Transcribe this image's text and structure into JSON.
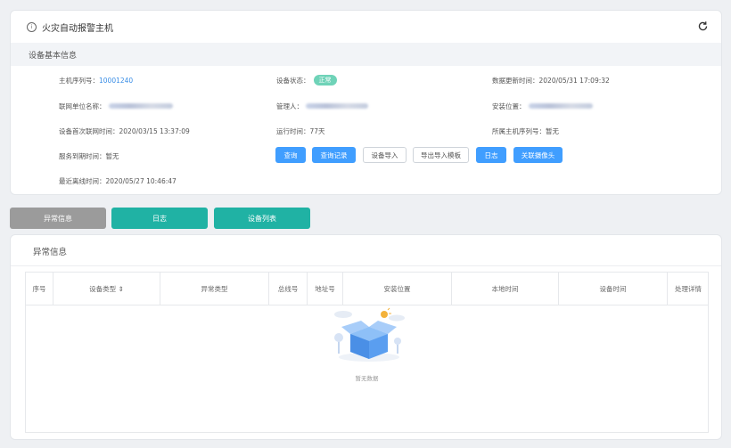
{
  "header": {
    "title": "火灾自动报警主机",
    "title_icon": "info-circle-icon",
    "refresh_icon": "refresh-icon"
  },
  "basic": {
    "section_title": "设备基本信息",
    "host_serial_label": "主机序列号：",
    "host_serial_value": "10001240",
    "device_status_label": "设备状态：",
    "device_status_value": "正常",
    "data_update_label": "数据更新时间：",
    "data_update_value": "2020/05/31 17:09:32",
    "unit_label": "联网单位名称：",
    "manager_label": "管理人：",
    "location_label": "安装位置：",
    "first_online_label": "设备首次联网时间：",
    "first_online_value": "2020/03/15 13:37:09",
    "runtime_label": "运行时间：",
    "runtime_value": "77天",
    "parent_serial_label": "所属主机序列号：",
    "parent_serial_value": "暂无",
    "service_expire_label": "服务到期时间：",
    "service_expire_value": "暂无",
    "last_offline_label": "最近离线时间：",
    "last_offline_value": "2020/05/27 10:46:47"
  },
  "actions": {
    "query": "查询",
    "query_records": "查询记录",
    "import_device": "设备导入",
    "export_template": "导出导入模板",
    "log": "日志",
    "link_camera": "关联摄像头"
  },
  "tabs": {
    "abnormal": "异常信息",
    "log": "日志",
    "device_list": "设备列表"
  },
  "abnormal": {
    "title": "异常信息",
    "columns": [
      "序号",
      "设备类型 ⇕",
      "异常类型",
      "总线号",
      "地址号",
      "安装位置",
      "本地时间",
      "设备时间",
      "处理详情"
    ],
    "empty_text": "暂无数据"
  },
  "colors": {
    "blue": "#409eff",
    "teal": "#20b2a4",
    "gray": "#9b9b9b",
    "status_green": "#6fd3b8"
  }
}
